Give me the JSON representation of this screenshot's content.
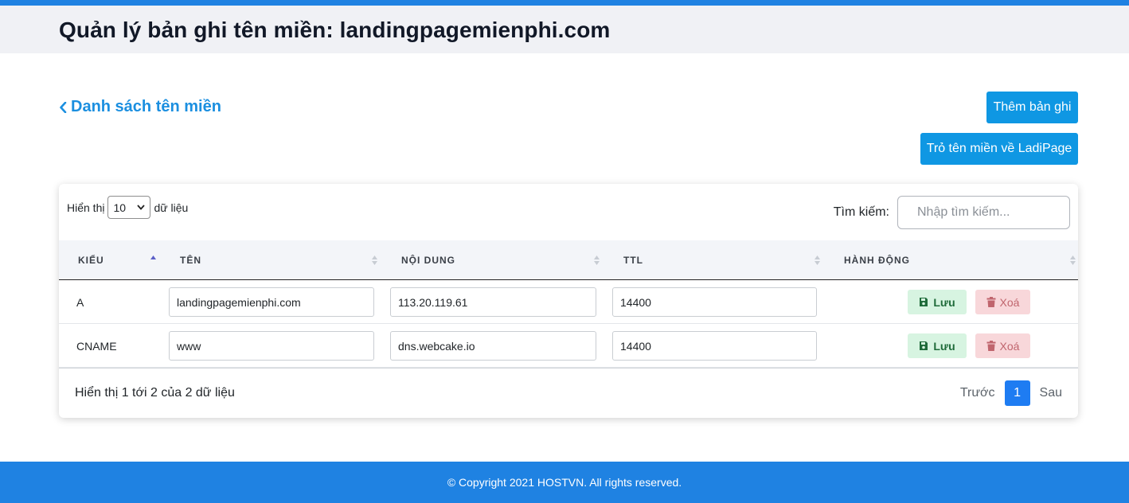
{
  "header": {
    "title": "Quản lý bản ghi tên miền: landingpagemienphi.com"
  },
  "nav": {
    "back_label": "Danh sách tên miền"
  },
  "actions": {
    "add_label": "Thêm bản ghi",
    "point_label": "Trỏ tên miền về LadiPage"
  },
  "table_controls": {
    "length_prefix": "Hiển thị",
    "length_value": "10",
    "length_suffix": "dữ liệu",
    "search_label": "Tìm kiếm:",
    "search_placeholder": "Nhập tìm kiếm..."
  },
  "columns": [
    "KIỂU",
    "TÊN",
    "NỘI DUNG",
    "TTL",
    "HÀNH ĐỘNG"
  ],
  "rows": [
    {
      "type": "A",
      "name": "landingpagemienphi.com",
      "content": "113.20.119.61",
      "ttl": "14400"
    },
    {
      "type": "CNAME",
      "name": "www",
      "content": "dns.webcake.io",
      "ttl": "14400"
    }
  ],
  "row_actions": {
    "save_label": "Lưu",
    "delete_label": "Xoá"
  },
  "pagination": {
    "info": "Hiển thị 1 tới 2 của 2 dữ liệu",
    "prev": "Trước",
    "current": "1",
    "next": "Sau"
  },
  "footer": {
    "copyright": "© Copyright 2021 HOSTVN. All rights reserved."
  },
  "colors": {
    "accent": "#1f82e2",
    "button": "#0f97e3",
    "save_bg": "#d7f4e1",
    "delete_bg": "#f8d7da"
  }
}
